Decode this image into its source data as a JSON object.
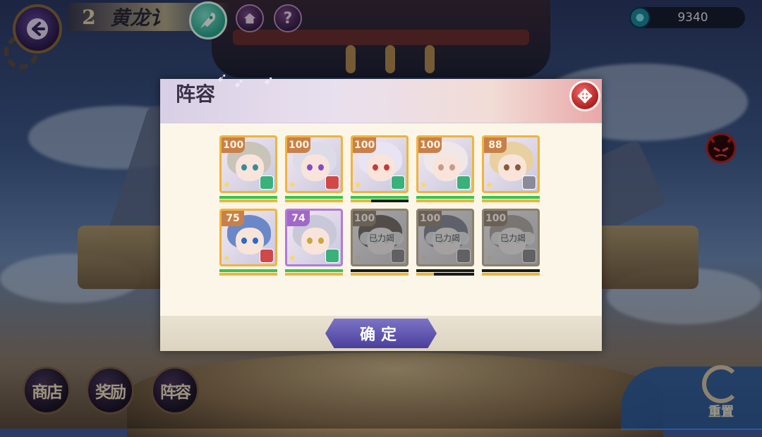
{
  "header": {
    "stage_number": "2",
    "stage_title": "黄龙讠",
    "home_icon": "home-icon",
    "help_label": "?",
    "rocket_icon": "rocket-icon"
  },
  "currency": {
    "value": "9340",
    "icon": "eye-orb-icon"
  },
  "bottom_buttons": {
    "shop": "商店",
    "rewards": "奖励",
    "lineup": "阵容",
    "reset": "重置"
  },
  "devil_label": "devil-mode-icon",
  "dialog": {
    "title": "阵容",
    "confirm_label": "确定",
    "dead_label": "已力竭",
    "heroes": [
      {
        "level": "100",
        "hp": 1.0,
        "energy": 1.0,
        "hair": "#c9c4b8",
        "eye": "#3a8a9a",
        "frame": "gold",
        "cls": "#3ab07a",
        "dead": false
      },
      {
        "level": "100",
        "hp": 1.0,
        "energy": 1.0,
        "hair": "#dcdce8",
        "eye": "#8a4ac8",
        "frame": "gold",
        "cls": "#d04848",
        "dead": false
      },
      {
        "level": "100",
        "hp": 1.0,
        "energy": 0.35,
        "hair": "#e8e4f4",
        "eye": "#c83a3a",
        "frame": "gold",
        "cls": "#3ab07a",
        "dead": false
      },
      {
        "level": "100",
        "hp": 1.0,
        "energy": 1.0,
        "hair": "#f0e8e8",
        "eye": "#c89a8a",
        "frame": "gold",
        "cls": "#3ab07a",
        "dead": false
      },
      {
        "level": "88",
        "hp": 1.0,
        "energy": 1.0,
        "hair": "#e8d0a0",
        "eye": "#8a5a3a",
        "frame": "gold",
        "cls": "#8a8a9a",
        "dead": false
      },
      {
        "level": "75",
        "hp": 1.0,
        "energy": 1.0,
        "hair": "#6a88c8",
        "eye": "#2a6ac8",
        "frame": "gold",
        "cls": "#d04848",
        "dead": false
      },
      {
        "level": "74",
        "hp": 1.0,
        "energy": 1.0,
        "hair": "#c8c8d8",
        "eye": "#c8a83a",
        "frame": "purple",
        "cls": "#3ab07a",
        "dead": false
      },
      {
        "level": "100",
        "hp": 0.0,
        "energy": 1.0,
        "hair": "#8a6a5a",
        "eye": "#5a4a4a",
        "frame": "gold",
        "cls": "#8a8a9a",
        "dead": true
      },
      {
        "level": "100",
        "hp": 0.0,
        "energy": 0.3,
        "hair": "#7a8ab8",
        "eye": "#4a5a8a",
        "frame": "gold",
        "cls": "#8a8a9a",
        "dead": true
      },
      {
        "level": "100",
        "hp": 0.0,
        "energy": 1.0,
        "hair": "#b8a890",
        "eye": "#6a5a4a",
        "frame": "gold",
        "cls": "#8a8a9a",
        "dead": true
      }
    ]
  }
}
